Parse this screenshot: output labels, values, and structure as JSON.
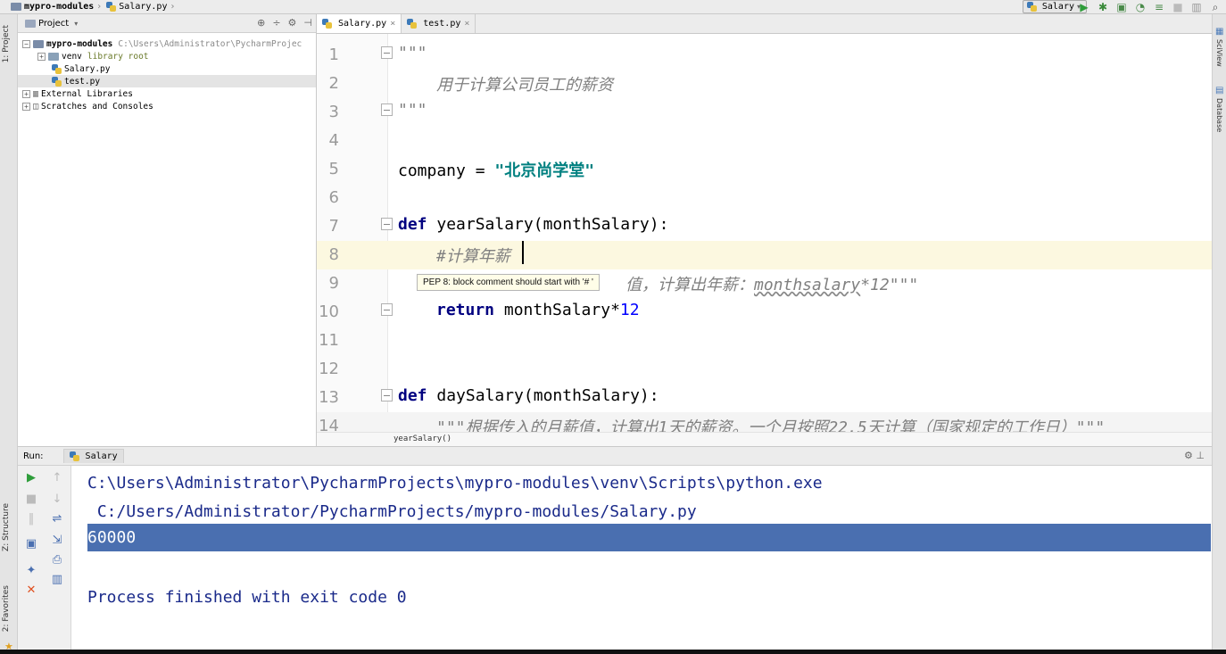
{
  "navbar": {
    "project": "mypro-modules",
    "file": "Salary.py",
    "run_config": "Salary"
  },
  "left_strip": {
    "project_tab": "1: Project",
    "structure_tab": "Z: Structure",
    "favorites_tab": "2: Favorites"
  },
  "right_strip": {
    "sciview_tab": "SciView",
    "database_tab": "Database"
  },
  "project_panel": {
    "title": "Project",
    "root_name": "mypro-modules",
    "root_path": "C:\\Users\\Administrator\\PycharmProjec",
    "venv": "venv",
    "venv_note": "library root",
    "file1": "Salary.py",
    "file2": "test.py",
    "external": "External Libraries",
    "scratches": "Scratches and Consoles"
  },
  "editor": {
    "tabs": [
      "Salary.py",
      "test.py"
    ],
    "line_numbers": [
      "1",
      "2",
      "3",
      "4",
      "5",
      "6",
      "7",
      "8",
      "9",
      "10",
      "11",
      "12",
      "13",
      "14"
    ],
    "line1": "\"\"\"",
    "line2": "用于计算公司员工的薪资",
    "line3": "\"\"\"",
    "line5_name": "company = ",
    "line5_str": "\"北京尚学堂\"",
    "line7_kw": "def ",
    "line7_rest": "yearSalary(monthSalary):",
    "line8_comment": "#计算年薪",
    "line9_visible": "值，计算出年薪：",
    "line9_squig": "monthsalary",
    "line9_tail": "*12\"\"\"",
    "line10_kw": "return ",
    "line10_rest": "monthSalary*",
    "line10_num": "12",
    "line13_kw": "def ",
    "line13_rest": "daySalary(monthSalary):",
    "line14": "\"\"\"根据传入的月薪值，计算出1天的薪资。一个月按照22.5天计算（国家规定的工作日）\"\"\"",
    "tooltip": "PEP 8: block comment should start with '# '",
    "breadcrumb": "yearSalary()"
  },
  "run": {
    "label": "Run:",
    "tab": "Salary",
    "console_line1": "C:\\Users\\Administrator\\PycharmProjects\\mypro-modules\\venv\\Scripts\\python.exe",
    "console_line2": " C:/Users/Administrator/PycharmProjects/mypro-modules/Salary.py",
    "console_output": "60000",
    "console_finish": "Process finished with exit code 0"
  }
}
